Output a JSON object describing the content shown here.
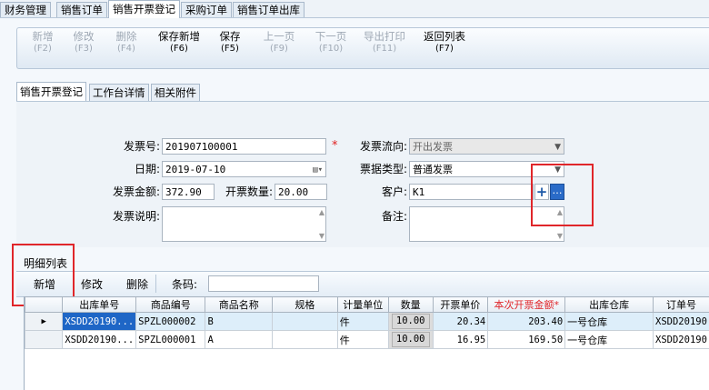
{
  "top_tabs": [
    "财务管理",
    "销售订单",
    "销售开票登记",
    "采购订单",
    "销售订单出库"
  ],
  "toolbar": [
    {
      "label": "新增",
      "key": "(F2)",
      "enabled": false
    },
    {
      "label": "修改",
      "key": "(F3)",
      "enabled": false
    },
    {
      "label": "删除",
      "key": "(F4)",
      "enabled": false
    },
    {
      "label": "保存新增",
      "key": "(F6)",
      "enabled": true
    },
    {
      "label": "保存",
      "key": "(F5)",
      "enabled": true
    },
    {
      "label": "上一页",
      "key": "(F9)",
      "enabled": false
    },
    {
      "label": "下一页",
      "key": "(F10)",
      "enabled": false
    },
    {
      "label": "导出打印",
      "key": "(F11)",
      "enabled": false
    },
    {
      "label": "返回列表",
      "key": "(F7)",
      "enabled": true
    }
  ],
  "sub_tabs": [
    "销售开票登记",
    "工作台详情",
    "相关附件"
  ],
  "form": {
    "invoice_no_label": "发票号:",
    "invoice_no": "201907100001",
    "date_label": "日期:",
    "date": "2019-07-10",
    "amount_label": "发票金额:",
    "amount": "372.90",
    "qty_label": "开票数量:",
    "qty": "20.00",
    "desc_label": "发票说明:",
    "desc": "",
    "direction_label": "发票流向:",
    "direction": "开出发票",
    "type_label": "票据类型:",
    "type": "普通发票",
    "customer_label": "客户:",
    "customer": "K1",
    "remark_label": "备注:",
    "remark": ""
  },
  "detail": {
    "title": "明细列表",
    "add": "新增",
    "edit": "修改",
    "delete": "删除",
    "barcode_label": "条码:",
    "barcode": ""
  },
  "grid": {
    "columns": [
      "出库单号",
      "商品编号",
      "商品名称",
      "规格",
      "计量单位",
      "数量",
      "开票单价",
      "本次开票金额*",
      "出库仓库",
      "订单号"
    ],
    "rows": [
      [
        "XSDD20190...",
        "SPZL000002",
        "B",
        "",
        "件",
        "10.00",
        "20.34",
        "203.40",
        "一号仓库",
        "XSDD20190"
      ],
      [
        "XSDD20190...",
        "SPZL000001",
        "A",
        "",
        "件",
        "10.00",
        "16.95",
        "169.50",
        "一号仓库",
        "XSDD20190"
      ]
    ]
  },
  "colors": {
    "red_highlight": "#e0262a",
    "required": "#e02020"
  }
}
